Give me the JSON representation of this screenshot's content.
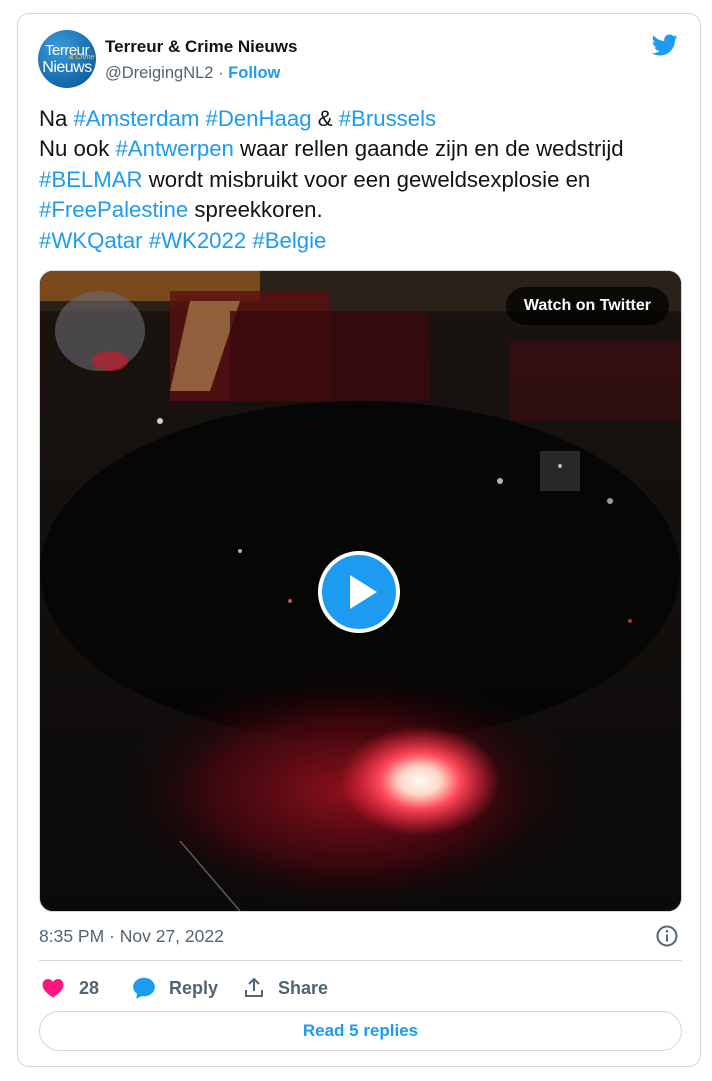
{
  "author": {
    "avatar_line1": "Terreur",
    "avatar_line2": "Nieuws",
    "avatar_accent": "& Crime",
    "name": "Terreur & Crime Nieuws",
    "handle": "@DreigingNL2",
    "separator": "·",
    "follow_label": "Follow"
  },
  "tweet": {
    "segments": [
      {
        "text": "Na ",
        "link": false
      },
      {
        "text": "#Amsterdam",
        "link": true
      },
      {
        "text": " ",
        "link": false
      },
      {
        "text": "#DenHaag",
        "link": true
      },
      {
        "text": " & ",
        "link": false
      },
      {
        "text": "#Brussels",
        "link": true
      },
      {
        "text": "\nNu ook ",
        "link": false
      },
      {
        "text": "#Antwerpen",
        "link": true
      },
      {
        "text": " waar rellen gaande zijn en de wedstrijd ",
        "link": false
      },
      {
        "text": "#BELMAR",
        "link": true
      },
      {
        "text": " wordt misbruikt voor een geweldsexplosie en ",
        "link": false
      },
      {
        "text": "#FreePalestine",
        "link": true
      },
      {
        "text": " spreekkoren.\n",
        "link": false
      },
      {
        "text": "#WKQatar",
        "link": true
      },
      {
        "text": " ",
        "link": false
      },
      {
        "text": "#WK2022",
        "link": true
      },
      {
        "text": " ",
        "link": false
      },
      {
        "text": "#Belgie",
        "link": true
      }
    ]
  },
  "media": {
    "watch_label": "Watch on Twitter",
    "play_icon": "play-icon"
  },
  "meta": {
    "timestamp": "8:35 PM · Nov 27, 2022"
  },
  "actions": {
    "like_count": "28",
    "reply_label": "Reply",
    "share_label": "Share"
  },
  "read_replies_label": "Read 5 replies",
  "colors": {
    "accent": "#1d9bf0",
    "like": "#f91880",
    "muted": "#536471",
    "border": "#cfd9de"
  }
}
